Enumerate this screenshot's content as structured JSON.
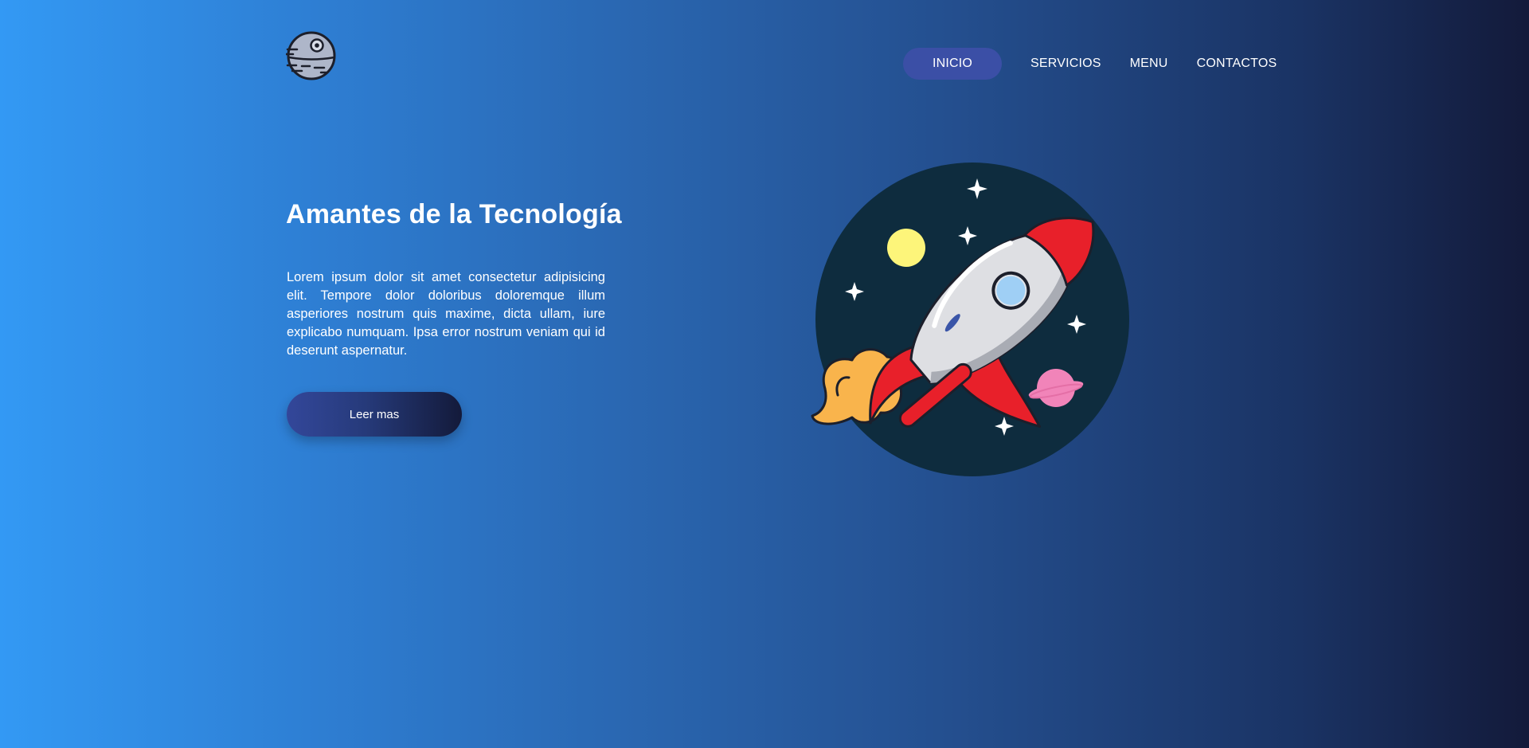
{
  "brand": {
    "logo_icon": "death-star-icon"
  },
  "nav": {
    "items": [
      {
        "label": "INICIO",
        "active": true
      },
      {
        "label": "SERVICIOS",
        "active": false
      },
      {
        "label": "MENU",
        "active": false
      },
      {
        "label": "CONTACTOS",
        "active": false
      }
    ]
  },
  "hero": {
    "title": "Amantes de la Tecnología",
    "text": "Lorem ipsum dolor sit amet consectetur adipisicing elit. Tempore dolor doloribus doloremque illum asperiores nostrum quis maxime, dicta ullam, iure explicabo numquam. Ipsa error nostrum veniam qui id deserunt aspernatur.",
    "button_label": "Leer mas",
    "illustration_icon": "rocket-illustration"
  },
  "colors": {
    "gradient_start": "#3399f4",
    "gradient_end": "#131a3a",
    "nav_active_bg": "#3b4fa6",
    "space_circle": "#0e2c3e",
    "rocket_red": "#e8202a",
    "flame_orange": "#f9b44c"
  }
}
